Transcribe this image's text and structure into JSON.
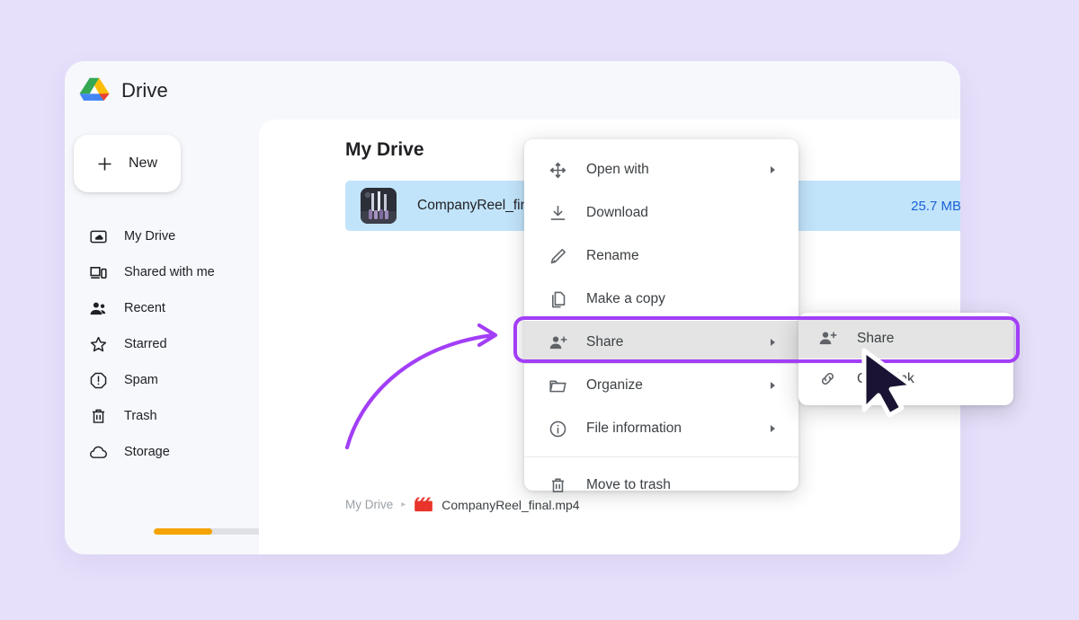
{
  "app": {
    "title": "Drive",
    "logo_icon": "google-drive-logo"
  },
  "sidebar": {
    "new_button": {
      "label": "New",
      "icon": "plus-icon"
    },
    "items": [
      {
        "label": "My Drive",
        "icon": "my-drive-icon"
      },
      {
        "label": "Shared with me",
        "icon": "shared-with-me-icon"
      },
      {
        "label": "Recent",
        "icon": "recent-people-icon"
      },
      {
        "label": "Starred",
        "icon": "star-icon"
      },
      {
        "label": "Spam",
        "icon": "spam-warning-icon"
      },
      {
        "label": "Trash",
        "icon": "trash-icon"
      },
      {
        "label": "Storage",
        "icon": "cloud-icon"
      }
    ],
    "storage": {
      "percent": 38,
      "fill_color": "#f5a302",
      "track_color": "#dfe1e5"
    }
  },
  "main": {
    "title": "My Drive",
    "file": {
      "name": "CompanyReel_final.mp4",
      "size": "25.7 MB",
      "thumbnail_icon": "video-thumbnail",
      "row_color": "#c2e4fb",
      "size_color": "#1a62d6"
    },
    "breadcrumb": {
      "root": "My Drive",
      "separator": "▸",
      "leaf": "CompanyReel_final.mp4",
      "leaf_icon": "clapperboard-icon"
    }
  },
  "context_menu": {
    "items": [
      {
        "label": "Open with",
        "icon": "open-with-move-icon",
        "has_submenu": true
      },
      {
        "label": "Download",
        "icon": "download-icon",
        "has_submenu": false
      },
      {
        "label": "Rename",
        "icon": "rename-pencil-icon",
        "has_submenu": false
      },
      {
        "label": "Make a copy",
        "icon": "copy-icon",
        "has_submenu": false
      },
      {
        "label": "Share",
        "icon": "share-person-add-icon",
        "has_submenu": true
      },
      {
        "label": "Organize",
        "icon": "folder-icon",
        "has_submenu": true
      },
      {
        "label": "File information",
        "icon": "info-circle-icon",
        "has_submenu": true
      },
      {
        "label": "Move to trash",
        "icon": "trash-icon",
        "has_submenu": false
      }
    ]
  },
  "submenu": {
    "items": [
      {
        "label": "Share",
        "icon": "share-person-add-icon"
      },
      {
        "label": "Copy link",
        "icon": "link-chain-icon"
      }
    ]
  },
  "annotation": {
    "arrow_icon": "curved-arrow",
    "highlight_color": "#a23ef7",
    "cursor_icon": "mouse-pointer"
  }
}
